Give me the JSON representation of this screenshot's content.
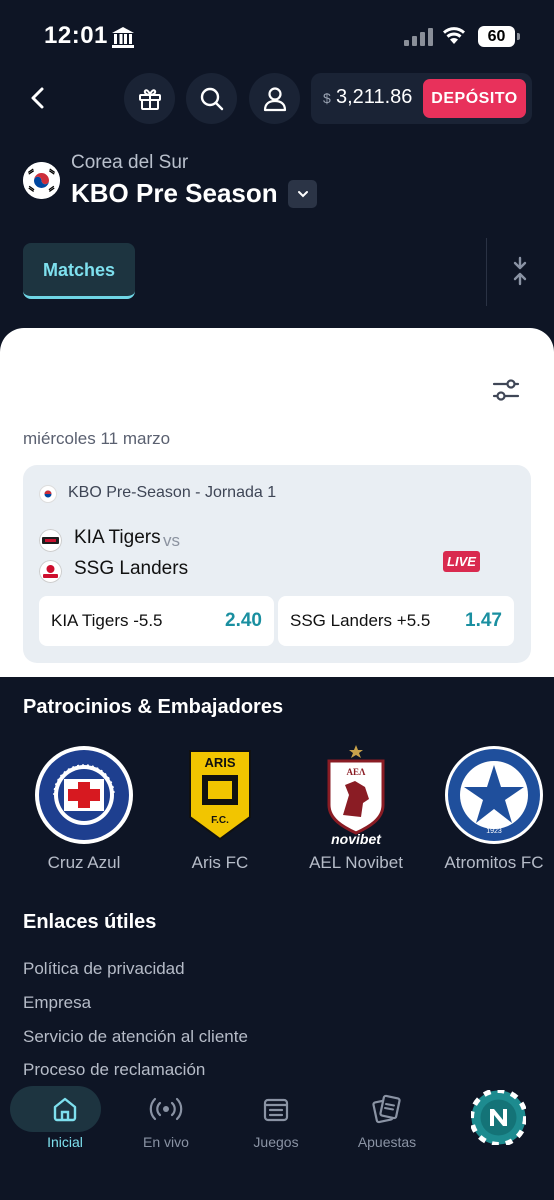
{
  "status_bar": {
    "time": "12:01",
    "battery": "60"
  },
  "header": {
    "balance_currency": "$",
    "balance_amount": "3,211.86",
    "deposit_label": "DEPÓSITO"
  },
  "league": {
    "country": "Corea del Sur",
    "name": "KBO Pre Season"
  },
  "tabs": {
    "matches_label": "Matches"
  },
  "panel": {
    "date": "miércoles 11 marzo",
    "match": {
      "competition": "KBO Pre-Season - Jornada 1",
      "home_team": "KIA Tigers",
      "vs": "vs",
      "away_team": "SSG Landers",
      "live_badge": "LIVE",
      "odds": [
        {
          "label": "KIA Tigers -5.5",
          "value": "2.40"
        },
        {
          "label": "SSG Landers +5.5",
          "value": "1.47"
        }
      ]
    }
  },
  "sponsors": {
    "title": "Patrocinios & Embajadores",
    "items": [
      {
        "name": "Cruz Azul",
        "logo_text": "CLUB DE FUTBOL CRUZ AZUL"
      },
      {
        "name": "Aris FC",
        "logo_text": "ARIS F.C."
      },
      {
        "name": "AEL Novibet",
        "logo_text": "ΑΕΛ novibet"
      },
      {
        "name": "Atromitos FC",
        "logo_text": "ΑΤΡΟΜΗΤΟΣ ΑΘΗΝΩΝ 1923"
      }
    ]
  },
  "useful_links": {
    "title": "Enlaces útiles",
    "items": [
      "Política de privacidad",
      "Empresa",
      "Servicio de atención al cliente",
      "Proceso de reclamación"
    ]
  },
  "bottom_nav": {
    "items": [
      {
        "label": "Inicial",
        "icon": "home-icon"
      },
      {
        "label": "En vivo",
        "icon": "live-broadcast-icon"
      },
      {
        "label": "Juegos",
        "icon": "games-icon"
      },
      {
        "label": "Apuestas",
        "icon": "bets-icon"
      }
    ]
  },
  "colors": {
    "background": "#0e1525",
    "accent": "#7ee0ee",
    "deposit": "#e8315b",
    "live": "#d92a4f",
    "odds_value": "#1a8fa0"
  }
}
